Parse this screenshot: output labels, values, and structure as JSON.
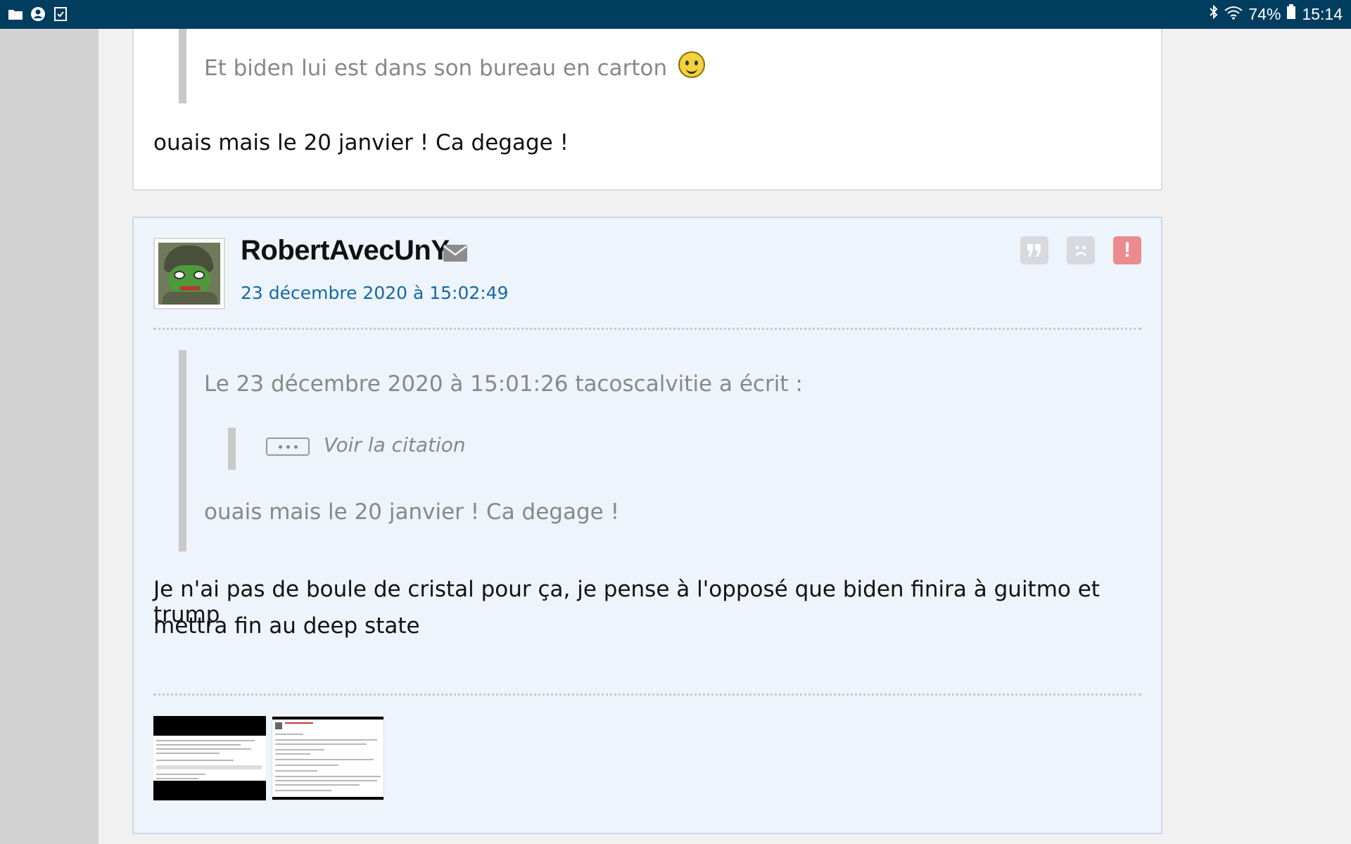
{
  "status_bar": {
    "left_icons": [
      "folder-icon",
      "account-circle-icon",
      "checklist-icon"
    ],
    "battery": "74%",
    "time": "15:14"
  },
  "previous_post": {
    "quote_text": "Et biden lui est dans son bureau en carton",
    "body": "ouais mais le 20 janvier ! Ca degage !"
  },
  "post": {
    "username": "RobertAvecUnY",
    "date": "23 décembre 2020 à 15:02:49",
    "quote_header": "Le 23 décembre 2020 à 15:01:26 tacoscalvitie a écrit :",
    "voir_citation": "Voir la citation",
    "quote_body": "ouais mais le 20 janvier ! Ca degage !",
    "body_line1": "Je n'ai pas de boule de cristal pour ça, je pense à l'opposé que biden finira à guitmo et trump",
    "body_line2": "mettra fin au deep state",
    "actions": [
      "quote-icon",
      "sad-face-icon",
      "alert-icon"
    ],
    "alert_symbol": "!"
  },
  "colors": {
    "status_bar": "#003d5f",
    "post_bg": "#eef4fc",
    "date_link": "#1569a5",
    "alert_button": "#eb8a8f"
  }
}
